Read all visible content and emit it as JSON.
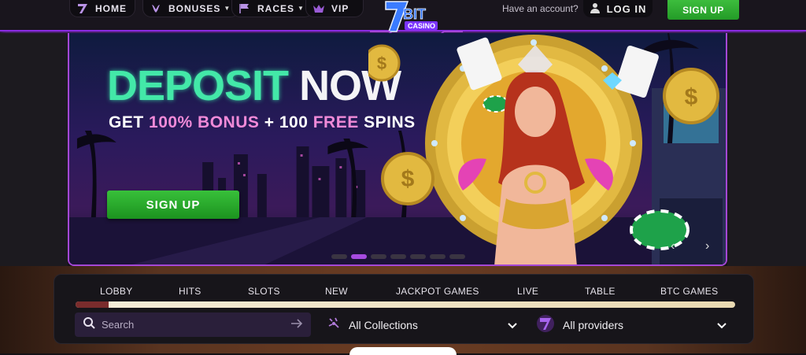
{
  "nav": {
    "home": "HOME",
    "bonuses": "BONUSES",
    "races": "RACES",
    "vip": "VIP"
  },
  "logo": {
    "text": "BIT CASINO"
  },
  "account": {
    "have_account": "Have an account?",
    "login": "LOG IN",
    "signup": "SIGN UP"
  },
  "banner": {
    "headline_1": "DEPOSIT",
    "headline_2": "NOW",
    "sub_1": "GET",
    "sub_2": "100% BONUS",
    "sub_3": "+ 100",
    "sub_4": "FREE",
    "sub_5": "SPINS",
    "cta": "SIGN UP",
    "slides": 7,
    "active_slide": 2
  },
  "tabs": [
    "LOBBY",
    "HITS",
    "SLOTS",
    "NEW",
    "JACKPOT GAMES",
    "LIVE",
    "TABLE",
    "BTC GAMES"
  ],
  "lobby_progress": 0.05,
  "search": {
    "placeholder": "Search"
  },
  "filters": {
    "collections": "All Collections",
    "providers": "All providers"
  },
  "colors": {
    "accent": "#a447d6",
    "signup": "#2aa52d",
    "headline_green": "#43e8a8",
    "headline_pink": "#f08ad8"
  }
}
